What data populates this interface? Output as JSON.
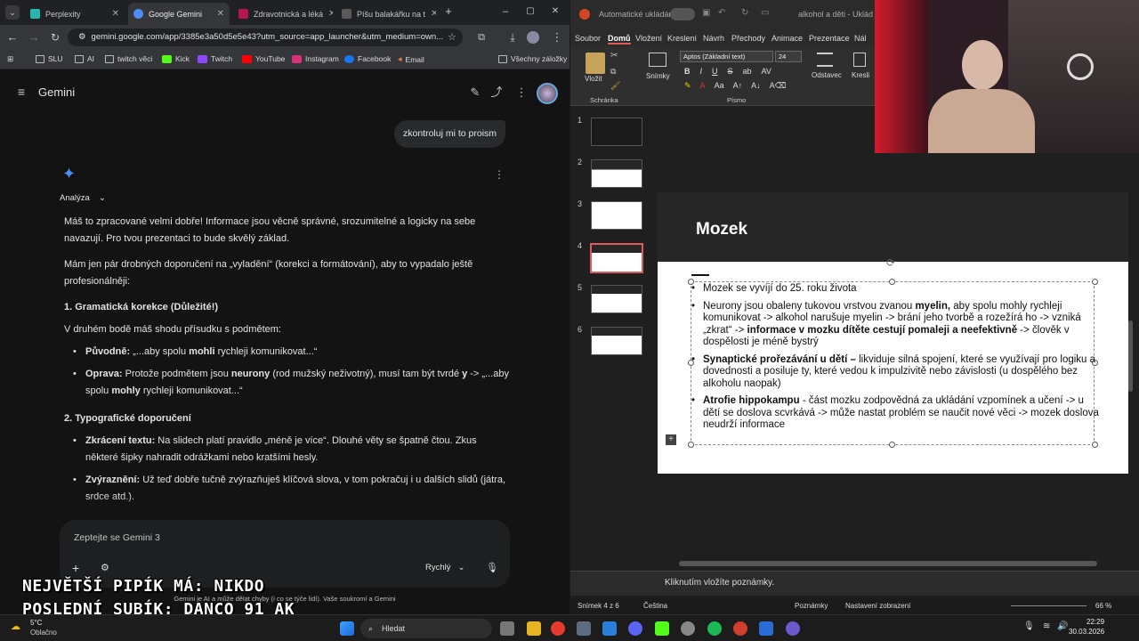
{
  "browser": {
    "tabs": [
      {
        "label": "Perplexity",
        "color": "#2ab6b0"
      },
      {
        "label": "Google Gemini",
        "color": "#4e8cf7"
      },
      {
        "label": "Zdravotnická a léká",
        "color": "#b3174e"
      },
      {
        "label": "Píšu balakářku na t",
        "color": "#888888"
      }
    ],
    "url": "gemini.google.com/app/3385e3a50d5e5e43?utm_source=app_launcher&utm_medium=own...",
    "bookmarks": [
      "SLU",
      "AI",
      "twitch věci",
      "Kick",
      "Twitch",
      "YouTube",
      "Instagram",
      "Facebook",
      "Email"
    ],
    "all_bookmarks": "Všechny záložky"
  },
  "gemini": {
    "title": "Gemini",
    "user_message": "zkontroluj mi to proism",
    "analysis_label": "Analýza",
    "p1": "Máš to zpracované velmi dobře! Informace jsou věcně správné, srozumitelné a logicky na sebe navazují. Pro tvou prezentaci to bude skvělý základ.",
    "p2": "Mám jen pár drobných doporučení na „vyladění“ (korekci a formátování), aby to vypadalo ještě profesionálněji:",
    "h1": "1. Gramatická korekce (Důležité!)",
    "p3": "V druhém bodě máš shodu přísudku s podmětem:",
    "b1_label": "Původně:",
    "b1_pre": " „...aby spolu ",
    "b1_bold": "mohli",
    "b1_post": " rychleji komunikovat...“",
    "b2_label": "Oprava:",
    "b2_pre": " Protože podmětem jsou ",
    "b2_bold1": "neurony",
    "b2_mid": " (rod mužský neživotný), musí tam být tvrdé ",
    "b2_bold2": "y",
    "b2_mid2": " -> „...aby spolu ",
    "b2_bold3": "mohly",
    "b2_post": " rychleji komunikovat...“",
    "h2": "2. Typografické doporučení",
    "b3_label": "Zkrácení textu:",
    "b3_text": " Na slidech platí pravidlo „méně je více“. Dlouhé věty se špatně čtou. Zkus některé šipky nahradit odrážkami nebo kratšími hesly.",
    "b4_label": "Zvýraznění:",
    "b4_text": " Už teď dobře tučně zvýrazňuješ klíčová slova, v tom pokračuj i u dalších slidů (játra, srdce atd.).",
    "prompt_placeholder": "Zeptejte se Gemini 3",
    "model_label": "Rychlý",
    "footnote": "Gemini je AI a může dělat chyby (i co se týče lidí). Vaše soukromí a Gemini"
  },
  "overlay": {
    "line1": "NEJVĚTŠÍ PIPÍK MÁ: NIKDO",
    "line2": "POSLEDNÍ SUBÍK: DANCO_91_AK"
  },
  "ppt": {
    "autosave": "Automatické ukládání",
    "filename": "alkohol a děti - Uklád",
    "tabs": [
      "Soubor",
      "Domů",
      "Vložení",
      "Kreslení",
      "Návrh",
      "Přechody",
      "Animace",
      "Prezentace",
      "Nál"
    ],
    "paste": "Vložit",
    "clipboard": "Schránka",
    "slides_btn": "Snímky",
    "font": "Aptos (Základní text)",
    "size": "24",
    "font_group": "Písmo",
    "paragraph": "Odstavec",
    "draw": "Kresli",
    "slide_numbers": [
      "1",
      "2",
      "3",
      "4",
      "5",
      "6"
    ],
    "slide_title": "Mozek",
    "bullet1": "Mozek se vyvíjí do 25. roku života",
    "bullet2_a": "Neurony jsou obaleny tukovou vrstvou zvanou ",
    "bullet2_b": "myelin,",
    "bullet2_c": " aby spolu mohly rychleji komunikovat -> alkohol narušuje myelin -> brání jeho tvorbě a rozežírá ho -> vzniká „zkrat“ -> ",
    "bullet2_d": "informace v mozku dítěte cestují pomaleji a neefektivně",
    "bullet2_e": " -> člověk v dospělosti je méně bystrý",
    "bullet3_a": "Synaptické prořezávání u dětí –",
    "bullet3_b": " likviduje silná spojení, které se využívají pro logiku a dovednosti a posiluje ty, které vedou k impulzivitě nebo závislosti (u dospělého bez alkoholu naopak)",
    "bullet4_a": "Atrofie hippokampu",
    "bullet4_b": " - část mozku zodpovědná za ukládání vzpomínek a učení -> u dětí se doslova scvrkává -> může nastat problém se naučit nové věci -> mozek doslova neudrží informace",
    "notes": "Kliknutím vložíte poznámky.",
    "status_slide": "Snímek 4 z 6",
    "status_lang": "Čeština",
    "status_notes": "Poznámky",
    "status_view": "Nastavení zobrazení",
    "zoom": "66 %"
  },
  "taskbar": {
    "weather_temp": "5°C",
    "weather_desc": "Oblačno",
    "search": "Hledat",
    "time": "22:29",
    "date": "30.03.2026"
  }
}
